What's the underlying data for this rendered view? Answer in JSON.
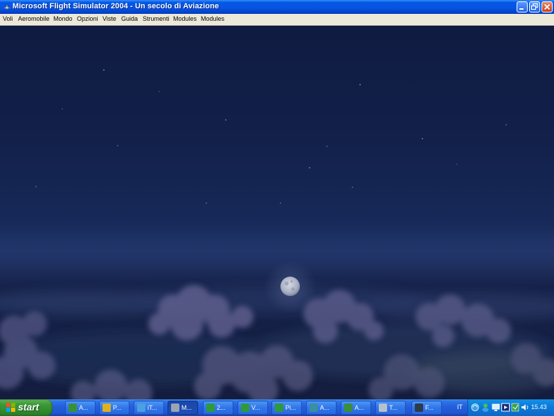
{
  "window": {
    "title": "Microsoft Flight Simulator 2004 - Un secolo di Aviazione",
    "controls": [
      "minimize-icon",
      "restore-icon",
      "close-icon"
    ]
  },
  "menu": {
    "items": [
      {
        "label": "Voli"
      },
      {
        "label": "Aeromobile"
      },
      {
        "label": "Mondo"
      },
      {
        "label": "Opzioni"
      },
      {
        "label": "Viste"
      },
      {
        "label": "Guida"
      },
      {
        "label": "Strumenti"
      },
      {
        "label": "Modules"
      },
      {
        "label": "Modules"
      }
    ]
  },
  "scene": {
    "description_icons": [
      "moon",
      "clouds",
      "stars"
    ]
  },
  "taskbar": {
    "start_label": "start",
    "tasks": [
      {
        "label": "A...",
        "icon": "app-icon",
        "color": "#3b8f3b"
      },
      {
        "label": "P...",
        "icon": "app-icon",
        "color": "#e0b020"
      },
      {
        "label": "iT...",
        "icon": "itunes-icon",
        "color": "#4aa0e0"
      },
      {
        "label": "M...",
        "icon": "flight-sim-icon",
        "color": "#9aa4b4",
        "active": true
      },
      {
        "label": "2...",
        "icon": "excel-icon",
        "color": "#2f9a3a"
      },
      {
        "label": "V...",
        "icon": "excel-icon",
        "color": "#2f9a3a"
      },
      {
        "label": "Pi...",
        "icon": "excel-icon",
        "color": "#2f9a3a"
      },
      {
        "label": "A...",
        "icon": "app-icon",
        "color": "#3a8fa0"
      },
      {
        "label": "A...",
        "icon": "app-icon",
        "color": "#3b8f3b"
      },
      {
        "label": "T...",
        "icon": "plane-icon",
        "color": "#b8c0cc"
      },
      {
        "label": "F...",
        "icon": "monitor-icon",
        "color": "#303a48"
      }
    ],
    "language": "IT",
    "tray_icons": [
      "network-icon",
      "messenger-icon",
      "monitor-icon",
      "media-icon",
      "antivirus-icon",
      "volume-icon"
    ],
    "clock": "15.43"
  }
}
